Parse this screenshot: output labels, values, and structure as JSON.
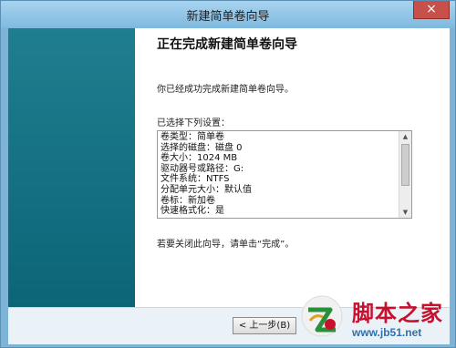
{
  "window": {
    "title": "新建简单卷向导",
    "close_glyph": "×"
  },
  "content": {
    "heading": "正在完成新建简单卷向导",
    "description": "你已经成功完成新建简单卷向导。",
    "settings_label": "已选择下列设置：",
    "settings": [
      "卷类型：简单卷",
      "选择的磁盘：磁盘 0",
      "卷大小：1024 MB",
      "驱动器号或路径：G:",
      "文件系统：NTFS",
      "分配单元大小：默认值",
      "卷标：新加卷",
      "快速格式化：是"
    ],
    "finish_note": "若要关闭此向导，请单击“完成”。"
  },
  "buttons": {
    "back_label": "< 上一步(B)"
  },
  "watermark": {
    "title": "脚本之家",
    "url": "www.jb51.net"
  },
  "colors": {
    "frame": "#7db3d6",
    "side_panel": "#0b6577",
    "close_button": "#c7504a"
  }
}
